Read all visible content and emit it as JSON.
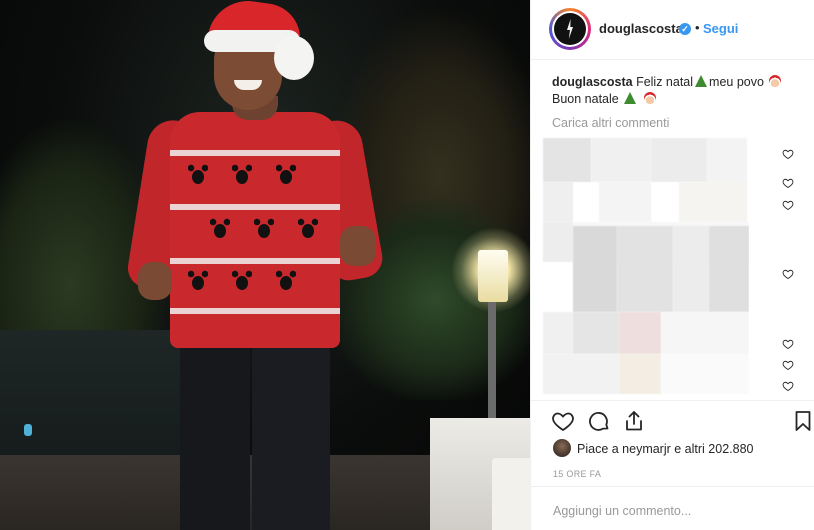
{
  "post": {
    "username": "douglascosta",
    "follow_label": "Segui",
    "dot": "•",
    "verified_mark": "✓"
  },
  "caption": {
    "username": "douglascosta",
    "text_1": "Feliz natal",
    "text_2": "meu povo",
    "text_3": "Buon natale"
  },
  "load_more_label": "Carica altri commenti",
  "likes": {
    "text": "Piace a neymarjr e altri 202.880"
  },
  "timestamp": "15 ORE FA",
  "add_comment_placeholder": "Aggiungi un commento...",
  "icons": {
    "header_avatar": "avatar-icon",
    "verified": "verified-badge-icon",
    "like": "heart-icon",
    "comment": "comment-icon",
    "share": "share-icon",
    "save": "bookmark-icon"
  },
  "colors": {
    "link_blue": "#3897f0",
    "muted_text": "#999999",
    "text": "#262626",
    "divider": "#efefef"
  }
}
